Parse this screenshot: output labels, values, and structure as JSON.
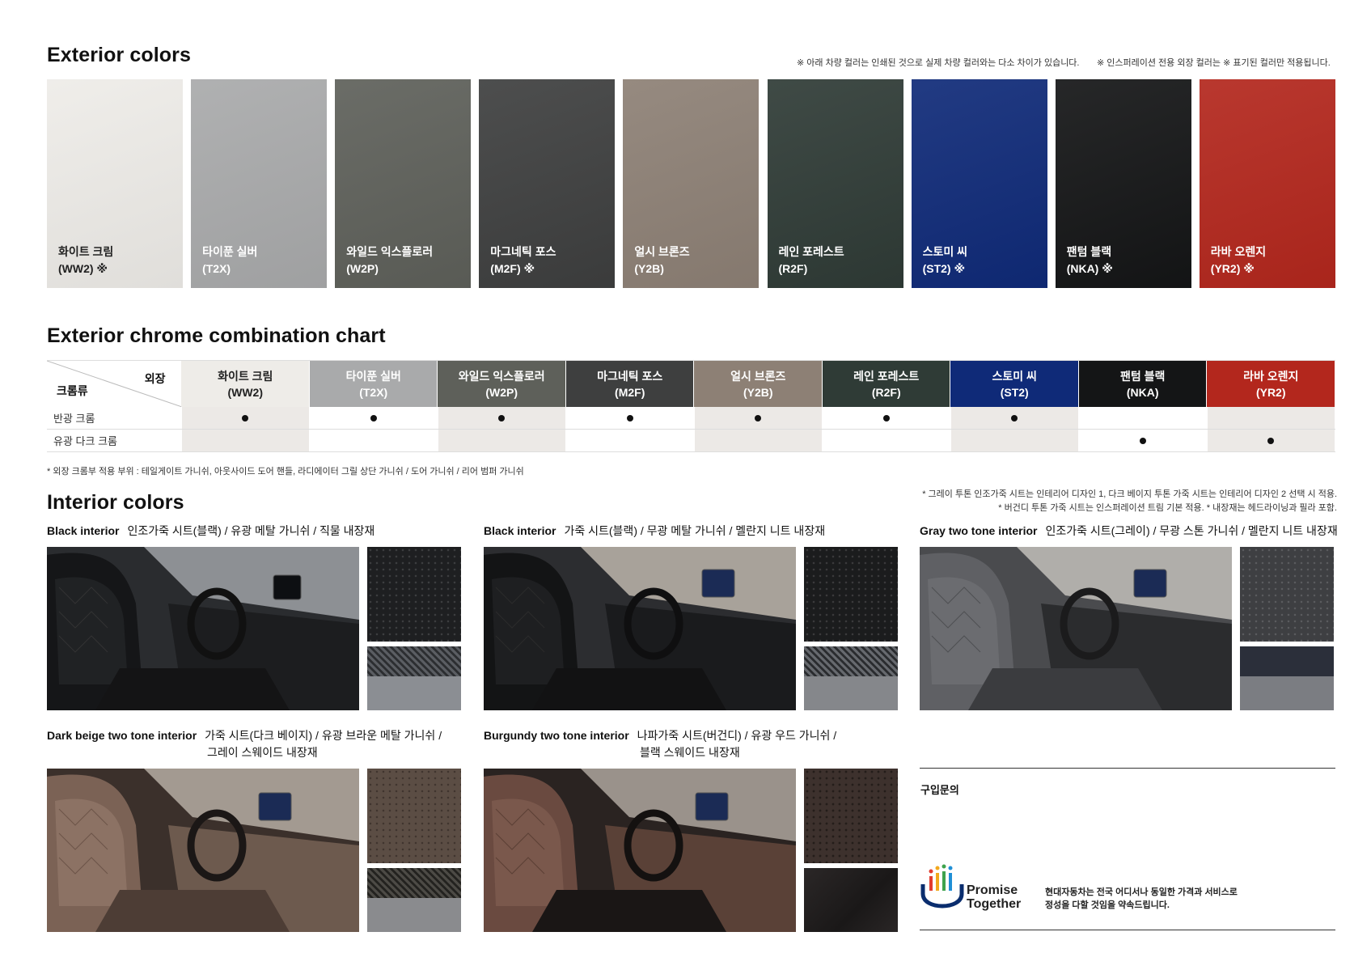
{
  "exterior": {
    "title": "Exterior colors",
    "note1": "※ 아래 차량 컬러는 인쇄된 것으로 실제 차량 컬러와는 다소 차이가 있습니다.",
    "note2": "※ 인스퍼레이션 전용 외장 컬러는 ※ 표기된 컬러만 적용됩니다.",
    "colors": [
      {
        "name": "화이트 크림",
        "code": "(WW2) ※",
        "hex": "#eeece8",
        "text": "#222"
      },
      {
        "name": "타이푼 실버",
        "code": "(T2X)",
        "hex": "#a9aaab",
        "text": "#fff"
      },
      {
        "name": "와일드 익스플로러",
        "code": "(W2P)",
        "hex": "#5e605a",
        "text": "#fff"
      },
      {
        "name": "마그네틱 포스",
        "code": "(M2F) ※",
        "hex": "#3e3f3f",
        "text": "#fff"
      },
      {
        "name": "얼시 브론즈",
        "code": "(Y2B)",
        "hex": "#8d8075",
        "text": "#fff"
      },
      {
        "name": "레인 포레스트",
        "code": "(R2F)",
        "hex": "#2f3b36",
        "text": "#fff"
      },
      {
        "name": "스토미 씨",
        "code": "(ST2) ※",
        "hex": "#0f2a78",
        "text": "#fff"
      },
      {
        "name": "팬텀 블랙",
        "code": "(NKA) ※",
        "hex": "#141516",
        "text": "#fff"
      },
      {
        "name": "라바 오렌지",
        "code": "(YR2) ※",
        "hex": "#b3271d",
        "text": "#fff"
      }
    ]
  },
  "chrome": {
    "title": "Exterior chrome combination chart",
    "corner_top": "외장",
    "corner_bottom": "크롬류",
    "rows": [
      {
        "label": "반광 크롬",
        "marks": [
          true,
          true,
          true,
          true,
          true,
          true,
          true,
          false,
          false
        ],
        "dot": "●"
      },
      {
        "label": "유광 다크 크롬",
        "marks": [
          false,
          false,
          false,
          false,
          false,
          false,
          false,
          true,
          true
        ],
        "dot": "●"
      }
    ],
    "footnote": "* 외장 크롬부 적용 부위 : 테일게이트 가니쉬, 아웃사이드 도어 핸들, 라디에이터 그릴 상단 가니쉬 / 도어 가니쉬 / 리어 범퍼 가니쉬"
  },
  "interior": {
    "title": "Interior colors",
    "note1": "* 그레이 투톤 인조가죽 시트는 인테리어 디자인 1, 다크 베이지 투톤 가죽 시트는 인테리어 디자인 2 선택 시 적용.",
    "note2": "* 버건디 투톤 가죽 시트는 인스퍼레이션 트림 기본 적용.   * 내장재는 헤드라이닝과 필라 포함.",
    "items": [
      {
        "name": "Black interior",
        "desc": "인조가죽 시트(블랙) / 유광 메탈 가니쉬 / 직물 내장재",
        "desc2": ""
      },
      {
        "name": "Black interior",
        "desc": "가죽 시트(블랙) / 무광 메탈 가니쉬 / 멜란지 니트 내장재",
        "desc2": ""
      },
      {
        "name": "Gray two tone interior",
        "desc": "인조가죽 시트(그레이) / 무광 스톤 가니쉬 / 멜란지 니트 내장재",
        "desc2": ""
      },
      {
        "name": "Dark beige two tone interior",
        "desc": "가죽 시트(다크 베이지) / 유광 브라운 메탈 가니쉬 /",
        "desc2": "그레이 스웨이드 내장재"
      },
      {
        "name": "Burgundy two tone interior",
        "desc": "나파가죽 시트(버건디) / 유광 우드 가니쉬 /",
        "desc2": "블랙 스웨이드 내장재"
      }
    ]
  },
  "purchase": {
    "label": "구입문의",
    "logo_line1": "Promise",
    "logo_line2": "Together",
    "slogan1": "현대자동차는 전국 어디서나 동일한 가격과 서비스로",
    "slogan2": "정성을 다할 것임을 약속드립니다."
  }
}
